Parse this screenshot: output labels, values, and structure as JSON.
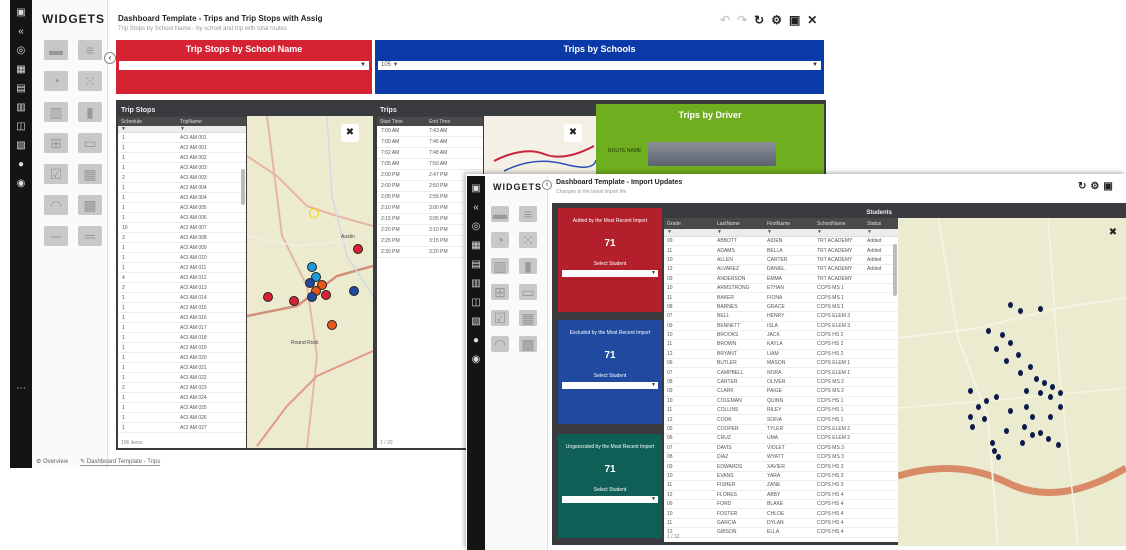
{
  "back": {
    "palette_title": "WIDGETS",
    "title": "Dashboard Template - Trips and Trip Stops with Assig",
    "subtitle": "Trip Stops by School Name - by school and trip with total routes",
    "panels": {
      "stops_by_school": {
        "title": "Trip Stops by School Name",
        "select_value": ""
      },
      "trips_by_schools": {
        "title": "Trips by Schools",
        "select_value": "105 ▼"
      },
      "trip_stops": {
        "title": "Trip Stops",
        "columns": [
          "Schedule",
          "TripName"
        ],
        "filter": [
          "▼",
          "▼"
        ],
        "footer": "106 items",
        "rows": [
          [
            "1",
            "ACI AM 001"
          ],
          [
            "1",
            "ACI AM 001"
          ],
          [
            "1",
            "ACI AM 002"
          ],
          [
            "1",
            "ACI AM 003"
          ],
          [
            "2",
            "ACI AM 003"
          ],
          [
            "1",
            "ACI AM 004"
          ],
          [
            "1",
            "ACI AM 004"
          ],
          [
            "1",
            "ACI AM 005"
          ],
          [
            "1",
            "ACI AM 006"
          ],
          [
            "10",
            "ACI AM 007"
          ],
          [
            "3",
            "ACI AM 008"
          ],
          [
            "1",
            "ACI AM 009"
          ],
          [
            "1",
            "ACI AM 010"
          ],
          [
            "1",
            "ACI AM 011"
          ],
          [
            "4",
            "ACI AM 012"
          ],
          [
            "2",
            "ACI AM 013"
          ],
          [
            "1",
            "ACI AM 014"
          ],
          [
            "1",
            "ACI AM 015"
          ],
          [
            "1",
            "ACI AM 016"
          ],
          [
            "1",
            "ACI AM 017"
          ],
          [
            "1",
            "ACI AM 018"
          ],
          [
            "1",
            "ACI AM 019"
          ],
          [
            "1",
            "ACI AM 020"
          ],
          [
            "1",
            "ACI AM 021"
          ],
          [
            "1",
            "ACI AM 022"
          ],
          [
            "2",
            "ACI AM 023"
          ],
          [
            "1",
            "ACI AM 024"
          ],
          [
            "1",
            "ACI AM 025"
          ],
          [
            "1",
            "ACI AM 026"
          ],
          [
            "1",
            "ACI AM 027"
          ]
        ]
      },
      "trips": {
        "title": "Trips",
        "columns": [
          "Start Time",
          "End Time"
        ],
        "footer": "1 / 20",
        "rows": [
          [
            "7:00 AM",
            "7:43 AM"
          ],
          [
            "7:00 AM",
            "7:45 AM"
          ],
          [
            "7:02 AM",
            "7:48 AM"
          ],
          [
            "7:05 AM",
            "7:50 AM"
          ],
          [
            "2:00 PM",
            "2:47 PM"
          ],
          [
            "2:00 PM",
            "2:50 PM"
          ],
          [
            "2:05 PM",
            "2:55 PM"
          ],
          [
            "2:10 PM",
            "3:00 PM"
          ],
          [
            "2:15 PM",
            "3:05 PM"
          ],
          [
            "2:20 PM",
            "3:10 PM"
          ],
          [
            "2:25 PM",
            "3:15 PM"
          ],
          [
            "2:30 PM",
            "3:20 PM"
          ]
        ]
      },
      "trips_by_driver": {
        "title": "Trips by Driver",
        "axis_label": "ROUTE NAME"
      }
    },
    "bottom_tabs": [
      "Overview",
      "Dashboard Template - Trips"
    ],
    "map_labels": [
      "Austin",
      "Round Rock"
    ]
  },
  "front": {
    "palette_title": "WIDGETS",
    "title": "Dashboard Template - Import Updates",
    "subtitle": "Changes to the latest import file",
    "cards": [
      {
        "label": "Added by the Most Recent Import",
        "value": "71",
        "button": "Select Student",
        "color": "#b3202c"
      },
      {
        "label": "Excluded by the Most Recent Import",
        "value": "71",
        "button": "Select Student",
        "color": "#1f4aa0"
      },
      {
        "label": "Ungeocoded by the Most Recent Import",
        "value": "71",
        "button": "Select Student",
        "color": "#0f5f57"
      }
    ],
    "table": {
      "title": "Students",
      "columns": [
        "Grade",
        "LastName",
        "FirstName",
        "SchoolName",
        "Status"
      ],
      "filter": [
        "▼",
        "▼",
        "▼",
        "▼",
        "▼"
      ],
      "rows": [
        [
          "09",
          "ABBOTT",
          "AIDEN",
          "TRT ACADEMY",
          "Added"
        ],
        [
          "11",
          "ADAMS",
          "BELLA",
          "TRT ACADEMY",
          "Added"
        ],
        [
          "10",
          "ALLEN",
          "CARTER",
          "TRT ACADEMY",
          "Added"
        ],
        [
          "12",
          "ALVAREZ",
          "DANIEL",
          "TRT ACADEMY",
          "Added"
        ],
        [
          "09",
          "ANDERSON",
          "EMMA",
          "TRT ACADEMY",
          ""
        ],
        [
          "10",
          "ARMSTRONG",
          "ETHAN",
          "CCPS MS 1",
          ""
        ],
        [
          "11",
          "BAKER",
          "FIONA",
          "CCPS MS 1",
          ""
        ],
        [
          "08",
          "BARNES",
          "GRACE",
          "CCPS MS 1",
          ""
        ],
        [
          "07",
          "BELL",
          "HENRY",
          "CCPS ELEM 3",
          ""
        ],
        [
          "09",
          "BENNETT",
          "ISLA",
          "CCPS ELEM 3",
          ""
        ],
        [
          "10",
          "BROOKS",
          "JACK",
          "CCPS HS 2",
          ""
        ],
        [
          "11",
          "BROWN",
          "KAYLA",
          "CCPS HS 2",
          ""
        ],
        [
          "12",
          "BRYANT",
          "LIAM",
          "CCPS HS 2",
          ""
        ],
        [
          "06",
          "BUTLER",
          "MASON",
          "CCPS ELEM 1",
          ""
        ],
        [
          "07",
          "CAMPBELL",
          "NORA",
          "CCPS ELEM 1",
          ""
        ],
        [
          "08",
          "CARTER",
          "OLIVER",
          "CCPS MS 2",
          ""
        ],
        [
          "09",
          "CLARK",
          "PAIGE",
          "CCPS MS 2",
          ""
        ],
        [
          "10",
          "COLEMAN",
          "QUINN",
          "CCPS HS 1",
          ""
        ],
        [
          "11",
          "COLLINS",
          "RILEY",
          "CCPS HS 1",
          ""
        ],
        [
          "12",
          "COOK",
          "SOFIA",
          "CCPS HS 1",
          ""
        ],
        [
          "05",
          "COOPER",
          "TYLER",
          "CCPS ELEM 2",
          ""
        ],
        [
          "06",
          "CRUZ",
          "UMA",
          "CCPS ELEM 2",
          ""
        ],
        [
          "07",
          "DAVIS",
          "VIOLET",
          "CCPS MS 3",
          ""
        ],
        [
          "08",
          "DIAZ",
          "WYATT",
          "CCPS MS 3",
          ""
        ],
        [
          "09",
          "EDWARDS",
          "XAVIER",
          "CCPS HS 3",
          ""
        ],
        [
          "10",
          "EVANS",
          "YARA",
          "CCPS HS 3",
          ""
        ],
        [
          "11",
          "FISHER",
          "ZANE",
          "CCPS HS 3",
          ""
        ],
        [
          "12",
          "FLORES",
          "ABBY",
          "CCPS HS 4",
          ""
        ],
        [
          "09",
          "FORD",
          "BLAKE",
          "CCPS HS 4",
          ""
        ],
        [
          "10",
          "FOSTER",
          "CHLOE",
          "CCPS HS 4",
          ""
        ],
        [
          "11",
          "GARCIA",
          "DYLAN",
          "CCPS HS 4",
          ""
        ],
        [
          "12",
          "GIBSON",
          "ELLA",
          "CCPS HS 4",
          ""
        ]
      ]
    },
    "footer": "1 / 32"
  },
  "colors": {
    "red": "#d62333",
    "blue": "#0a3aa8",
    "green": "#6fae1f",
    "rail": "#141414",
    "panel": "#3a3b3e"
  }
}
